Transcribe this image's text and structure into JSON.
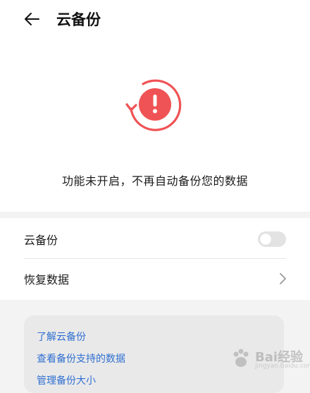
{
  "header": {
    "title": "云备份"
  },
  "status": {
    "message": "功能未开启，不再自动备份您的数据",
    "accent_color": "#f05355"
  },
  "settings": {
    "rows": [
      {
        "label": "云备份",
        "control": "toggle",
        "state": "off"
      },
      {
        "label": "恢复数据",
        "control": "chevron"
      }
    ]
  },
  "links": {
    "items": [
      {
        "label": "了解云备份"
      },
      {
        "label": "查看备份支持的数据"
      },
      {
        "label": "管理备份大小"
      }
    ],
    "color": "#2f6fd1"
  },
  "watermark": {
    "text": "Bai经验",
    "sub": "jingyan.baidu.com"
  }
}
